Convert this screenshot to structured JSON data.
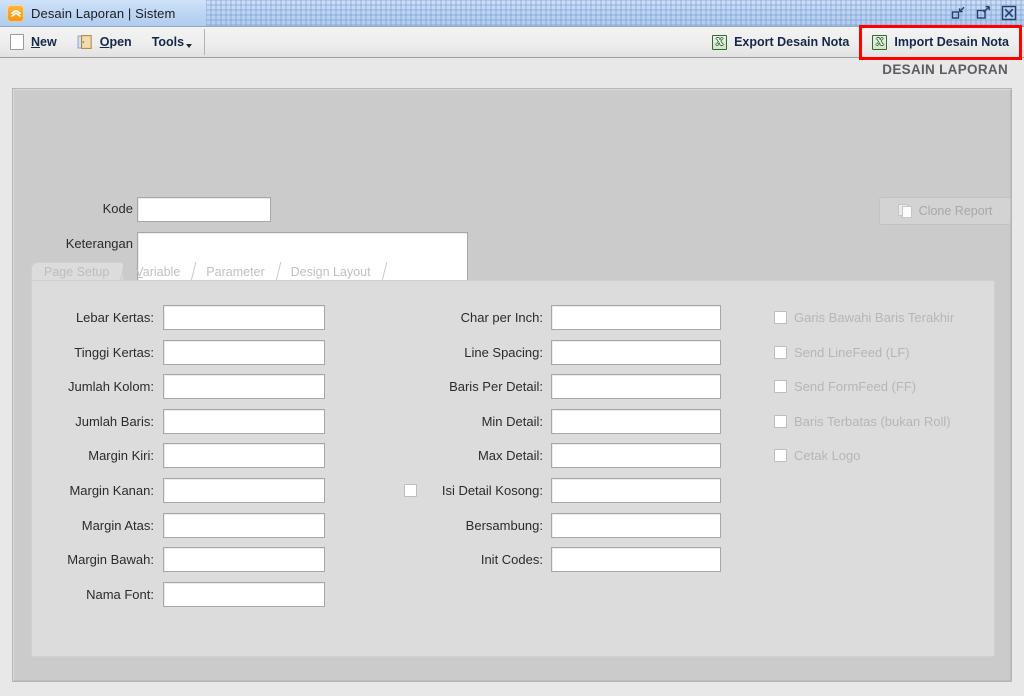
{
  "window": {
    "title": "Desain Laporan | Sistem",
    "app_icon": "chevrons-hexagon-icon",
    "controls": [
      {
        "name": "restore-down-button",
        "glyph": "restore-icon"
      },
      {
        "name": "maximize-button",
        "glyph": "maximize-icon"
      },
      {
        "name": "close-button",
        "glyph": "close-icon"
      }
    ]
  },
  "toolbar": {
    "new_label": "New",
    "open_label": "Open",
    "tools_label": "Tools",
    "export_label": "Export Desain Nota",
    "import_label": "Import Desain Nota",
    "highlight_color": "#fe0000"
  },
  "header": {
    "caption": "DESAIN LAPORAN"
  },
  "form": {
    "kode_label": "Kode",
    "kode_value": "",
    "keterangan_label": "Keterangan",
    "keterangan_value": "",
    "clone_label": "Clone Report",
    "clone_enabled": false
  },
  "tabs": [
    {
      "label": "Page Setup",
      "selected": true
    },
    {
      "label": "Variable",
      "selected": false
    },
    {
      "label": "Parameter",
      "selected": false
    },
    {
      "label": "Design Layout",
      "selected": false
    }
  ],
  "page_setup": {
    "left_fields": [
      {
        "label": "Lebar Kertas:",
        "value": ""
      },
      {
        "label": "Tinggi Kertas:",
        "value": ""
      },
      {
        "label": "Jumlah Kolom:",
        "value": ""
      },
      {
        "label": "Jumlah Baris:",
        "value": ""
      },
      {
        "label": "Margin Kiri:",
        "value": ""
      },
      {
        "label": "Margin Kanan:",
        "value": ""
      },
      {
        "label": "Margin Atas:",
        "value": ""
      },
      {
        "label": "Margin Bawah:",
        "value": ""
      },
      {
        "label": "Nama Font:",
        "value": ""
      }
    ],
    "middle_fields": [
      {
        "label": "Char per Inch:",
        "value": "",
        "checkbox": false
      },
      {
        "label": "Line Spacing:",
        "value": "",
        "checkbox": false
      },
      {
        "label": "Baris Per Detail:",
        "value": "",
        "checkbox": false
      },
      {
        "label": "Min Detail:",
        "value": "",
        "checkbox": false
      },
      {
        "label": "Max Detail:",
        "value": "",
        "checkbox": false
      },
      {
        "label": "Isi Detail Kosong:",
        "value": "",
        "checkbox": true,
        "checked": false
      },
      {
        "label": "Bersambung:",
        "value": "",
        "checkbox": false
      },
      {
        "label": "Init Codes:",
        "value": "",
        "checkbox": false
      }
    ],
    "right_checkboxes": [
      {
        "label": "Garis Bawahi Baris Terakhir",
        "checked": false,
        "enabled": false
      },
      {
        "label": "Send LineFeed (LF)",
        "checked": false,
        "enabled": false
      },
      {
        "label": "Send FormFeed (FF)",
        "checked": false,
        "enabled": false
      },
      {
        "label": "Baris Terbatas (bukan Roll)",
        "checked": false,
        "enabled": false
      },
      {
        "label": "Cetak Logo",
        "checked": false,
        "enabled": false
      }
    ]
  }
}
